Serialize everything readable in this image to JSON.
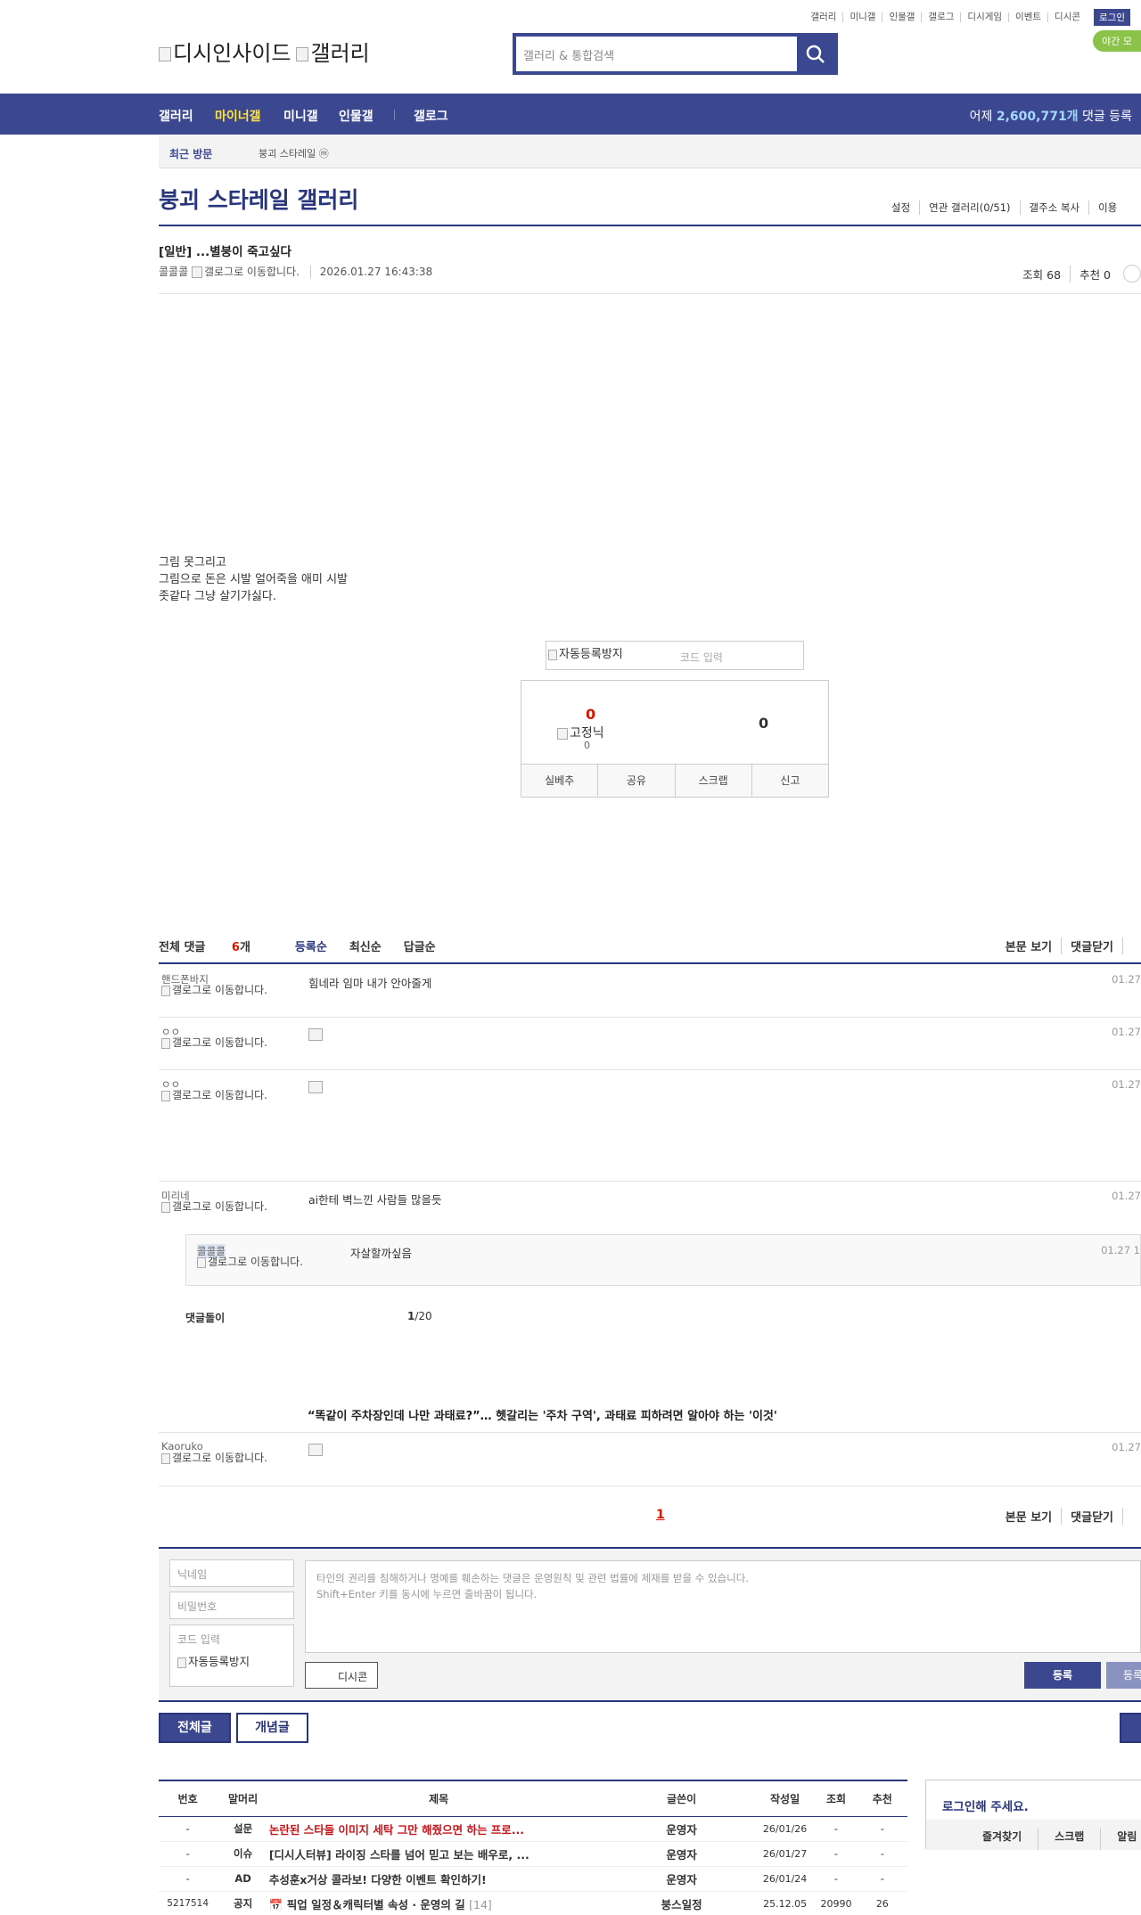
{
  "top": {
    "links": [
      "갤러리",
      "미니갤",
      "인물갤",
      "갤로그",
      "디시게임",
      "이벤트",
      "디시콘"
    ],
    "login": "로그인",
    "night": "야간 모"
  },
  "logo": {
    "a": "디시인사이드",
    "b": "갤러리"
  },
  "search": {
    "placeholder": "갤러리 & 통합검색"
  },
  "gnb": {
    "items": [
      "갤러리",
      "마이너갤",
      "미니갤",
      "인물갤",
      "갤로그"
    ],
    "stat_prefix": "어제 ",
    "stat_num": "2,600,771개",
    "stat_suffix": " 댓글 등록"
  },
  "recent": {
    "title": "최근 방문",
    "item": "붕괴 스타레일 ⓜ"
  },
  "gallery": {
    "title": "붕괴 스타레일 갤러리",
    "options": [
      "설정",
      "연관 갤러리(0/51)",
      "갤주소 복사",
      "이용"
    ]
  },
  "post": {
    "title": "[일반] ...별붕이 죽고싶다",
    "author": "콜콜콜",
    "gallog_alt": "갤로그로 이동합니다.",
    "date": "2026.01.27 16:43:38",
    "views": "조회 68",
    "recommend": "추천 0",
    "body": [
      "그림 못그리고",
      "그림으로 돈은 시발 얼어죽을 애미 시발",
      "좃같다 그냥 살기가싫다."
    ]
  },
  "captcha": {
    "alt": "자동등록방지",
    "placeholder": "코드 입력"
  },
  "rec": {
    "up": "0",
    "fixed": "고정닉",
    "fixed_count": "0",
    "down": "0",
    "buttons": [
      "실베추",
      "공유",
      "스크랩",
      "신고"
    ]
  },
  "comments_head": {
    "total_label": "전체 댓글 ",
    "count": "6",
    "unit": "개",
    "sorts": [
      "등록순",
      "최신순",
      "답글순"
    ],
    "right": [
      "본문 보기",
      "댓글닫기"
    ]
  },
  "comments": [
    {
      "nick": "핸드폰바지",
      "gal": "갤로그로 이동합니다.",
      "text": "힘네라 임마 내가 안아줄게",
      "date": "01.27"
    },
    {
      "nick": "ㅇㅇ",
      "gal": "갤로그로 이동합니다.",
      "text": "",
      "date": "01.27"
    },
    {
      "nick": "ㅇㅇ",
      "gal": "갤로그로 이동합니다.",
      "text": "",
      "date": "01.27"
    },
    {
      "nick": "미리네",
      "gal": "갤로그로 이동합니다.",
      "text": "ai한테 벽느낀 사람들 많을듯",
      "date": "01.27"
    },
    {
      "nick": "Kaoruko",
      "gal": "갤로그로 이동합니다.",
      "text": "",
      "date": "01.27"
    }
  ],
  "reply": {
    "nick": "콜콜콜",
    "gal": "갤로그로 이동합니다.",
    "text": "자살할까싶음",
    "date": "01.27 1"
  },
  "bot": {
    "label": "댓글돌이",
    "page": "1",
    "total": "/20"
  },
  "ad_text": "“똑같이 주차장인데 나만 과태료?”… 헷갈리는 '주차 구역', 과태료 피하려면 알아야 하는 '이것'",
  "page_num": "1",
  "write": {
    "nick_ph": "닉네임",
    "pw_ph": "비밀번호",
    "code_ph": "코드 입력",
    "captcha_alt": "자동등록방지",
    "notice1": "타인의 권리를 침해하거나 명예를 훼손하는 댓글은 운영원칙 및 관련 법률에 제재를 받을 수 있습니다.",
    "notice2": "Shift+Enter 키를 동시에 누르면 줄바꿈이 됩니다.",
    "dccon": "디시콘",
    "submit": "등록",
    "submit2": "등록"
  },
  "list_buttons": {
    "all": "전체글",
    "best": "개념글"
  },
  "table": {
    "headers": [
      "번호",
      "말머리",
      "제목",
      "글쓴이",
      "작성일",
      "조회",
      "추천"
    ],
    "rows": [
      {
        "no": "-",
        "tag": "설문",
        "title": "논란된 스타들 이미지 세탁 그만 해줬으면 하는 프로...",
        "writer": "운영자",
        "date": "26/01/26",
        "views": "-",
        "rec": "-",
        "red": true
      },
      {
        "no": "-",
        "tag": "이슈",
        "title": "[디시人터뷰] 라이징 스타를 넘어 믿고 보는 배우로, ...",
        "writer": "운영자",
        "date": "26/01/27",
        "views": "-",
        "rec": "-",
        "red": false
      },
      {
        "no": "-",
        "tag": "AD",
        "title": "추성훈x거상 콜라보! 다양한 이벤트 확인하기!",
        "writer": "운영자",
        "date": "26/01/24",
        "views": "-",
        "rec": "-",
        "red": false
      },
      {
        "no": "5217514",
        "tag": "공지",
        "title": "📅 픽업 일정＆캐릭터별 속성 · 운영의 길",
        "cnt": "[14]",
        "writer": "붕스일정",
        "date": "25.12.05",
        "views": "20990",
        "rec": "26",
        "red": false
      }
    ]
  },
  "side": {
    "title": "로그인해 주세요.",
    "menu": [
      "즐겨찾기",
      "스크랩",
      "알림"
    ]
  },
  "colors": {
    "navy": "#3b4890",
    "dark_navy": "#29367c",
    "accent_red": "#d31900",
    "yellow": "#ffe23c"
  }
}
